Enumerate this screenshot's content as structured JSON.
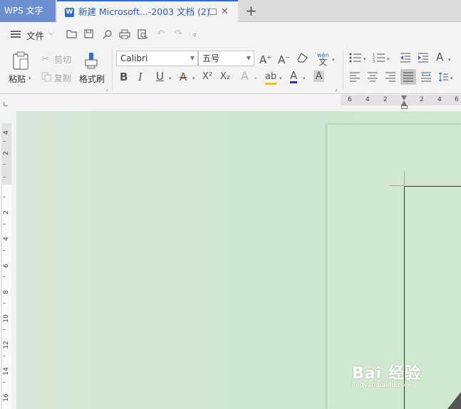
{
  "titlebar": {
    "app_tab": "WPS 文字",
    "doc_tab": "新建 Microsoft...-2003 文档 (2)",
    "close_glyph": "✕",
    "new_tab_glyph": "+"
  },
  "quickbar": {
    "file_label": "文件"
  },
  "ribbon": {
    "paste_label": "粘贴",
    "cut_label": "剪切",
    "copy_label": "复制",
    "format_painter_label": "格式刷",
    "font_name": "Calibri",
    "font_size": "五号",
    "bold": "B",
    "italic": "I",
    "underline": "U",
    "strike": "A",
    "superscript": "X²",
    "subscript": "X₂",
    "text_effect": "A",
    "highlight": "ab",
    "font_color": "A",
    "char_shading": "A",
    "grow_font": "A",
    "shrink_font": "A",
    "phonetic": "wén"
  },
  "hruler": {
    "labels": [
      "6",
      "4",
      "2",
      "2",
      "2",
      "4",
      "6"
    ]
  },
  "vruler": {
    "labels": [
      "4",
      "2",
      "2",
      "2",
      "4",
      "6",
      "8",
      "10",
      "12",
      "14",
      "16"
    ]
  },
  "watermark": {
    "brand": "Bai 经验",
    "url": "jingyan.baidu.com"
  },
  "colors": {
    "app_tab_bg": "#6c8fd0",
    "accent": "#2b6dd6",
    "canvas": "#cfe8cf"
  }
}
